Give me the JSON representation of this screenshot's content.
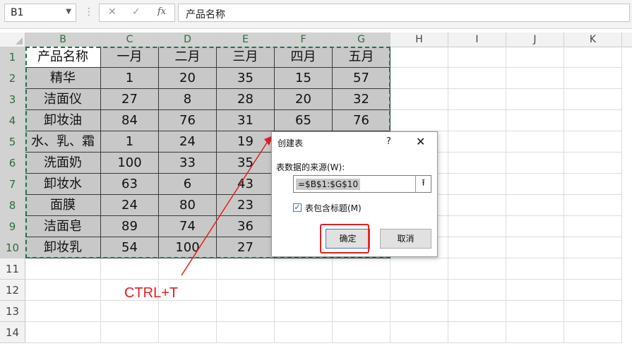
{
  "formula_bar": {
    "name_box": "B1",
    "cancel": "✕",
    "enter": "✓",
    "fx": "fx",
    "formula": "产品名称"
  },
  "columns": [
    "B",
    "C",
    "D",
    "E",
    "F",
    "G",
    "H",
    "I",
    "J",
    "K"
  ],
  "rows": [
    "1",
    "2",
    "3",
    "4",
    "5",
    "6",
    "7",
    "8",
    "9",
    "10",
    "11",
    "12",
    "13",
    "14"
  ],
  "table": [
    [
      "产品名称",
      "一月",
      "二月",
      "三月",
      "四月",
      "五月"
    ],
    [
      "精华",
      "1",
      "20",
      "35",
      "15",
      "57"
    ],
    [
      "洁面仪",
      "27",
      "8",
      "28",
      "20",
      "32"
    ],
    [
      "卸妆油",
      "84",
      "76",
      "31",
      "65",
      "76"
    ],
    [
      "水、乳、霜",
      "1",
      "24",
      "19",
      "",
      ""
    ],
    [
      "洗面奶",
      "100",
      "33",
      "35",
      "",
      ""
    ],
    [
      "卸妆水",
      "63",
      "6",
      "43",
      "",
      ""
    ],
    [
      "面膜",
      "24",
      "80",
      "23",
      "",
      ""
    ],
    [
      "洁面皂",
      "89",
      "74",
      "36",
      "",
      ""
    ],
    [
      "卸妆乳",
      "54",
      "100",
      "27",
      "",
      ""
    ]
  ],
  "dialog": {
    "title": "创建表",
    "help": "?",
    "close": "✕",
    "source_label": "表数据的来源(W):",
    "source_value": "=$B$1:$G$10",
    "collapse": "⭱",
    "has_headers_label": "表包含标题(M)",
    "has_headers_checked": "✓",
    "ok_label": "确定",
    "cancel_label": "取消"
  },
  "annotation": {
    "text": "CTRL+T",
    "color": "#e02020"
  },
  "colors": {
    "selection_border": "#217346",
    "table_fill": "#c8c8c8"
  }
}
